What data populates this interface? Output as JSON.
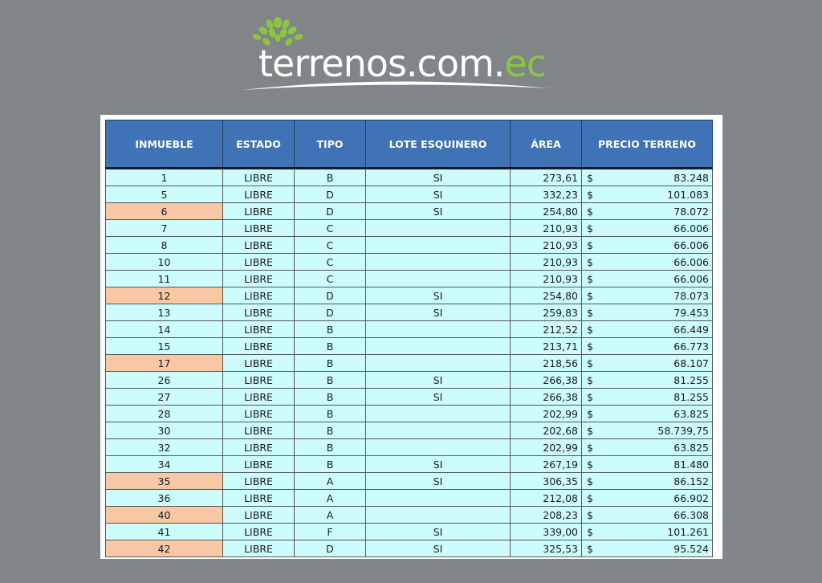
{
  "brand": {
    "name_main": "terrenos.com.",
    "name_tld": "ec",
    "colors": {
      "leaf": "#8cc63f",
      "text": "#ffffff",
      "background": "#808587"
    }
  },
  "table": {
    "columns": [
      "INMUEBLE",
      "ESTADO",
      "TIPO",
      "LOTE ESQUINERO",
      "ÁREA",
      "PRECIO TERRENO"
    ],
    "currency_symbol": "$",
    "header_color": "#3f73b5",
    "cell_color": "#ccfcfc",
    "highlight_color": "#f8c8a4",
    "rows": [
      {
        "inmueble": "1",
        "estado": "LIBRE",
        "tipo": "B",
        "esquinero": "SI",
        "area": "273,61",
        "precio": "83.248",
        "highlight": false
      },
      {
        "inmueble": "5",
        "estado": "LIBRE",
        "tipo": "D",
        "esquinero": "SI",
        "area": "332,23",
        "precio": "101.083",
        "highlight": false
      },
      {
        "inmueble": "6",
        "estado": "LIBRE",
        "tipo": "D",
        "esquinero": "SI",
        "area": "254,80",
        "precio": "78.072",
        "highlight": true
      },
      {
        "inmueble": "7",
        "estado": "LIBRE",
        "tipo": "C",
        "esquinero": "",
        "area": "210,93",
        "precio": "66.006",
        "highlight": false
      },
      {
        "inmueble": "8",
        "estado": "LIBRE",
        "tipo": "C",
        "esquinero": "",
        "area": "210,93",
        "precio": "66.006",
        "highlight": false
      },
      {
        "inmueble": "10",
        "estado": "LIBRE",
        "tipo": "C",
        "esquinero": "",
        "area": "210,93",
        "precio": "66.006",
        "highlight": false
      },
      {
        "inmueble": "11",
        "estado": "LIBRE",
        "tipo": "C",
        "esquinero": "",
        "area": "210,93",
        "precio": "66.006",
        "highlight": false
      },
      {
        "inmueble": "12",
        "estado": "LIBRE",
        "tipo": "D",
        "esquinero": "SI",
        "area": "254,80",
        "precio": "78.073",
        "highlight": true
      },
      {
        "inmueble": "13",
        "estado": "LIBRE",
        "tipo": "D",
        "esquinero": "SI",
        "area": "259,83",
        "precio": "79.453",
        "highlight": false
      },
      {
        "inmueble": "14",
        "estado": "LIBRE",
        "tipo": "B",
        "esquinero": "",
        "area": "212,52",
        "precio": "66.449",
        "highlight": false
      },
      {
        "inmueble": "15",
        "estado": "LIBRE",
        "tipo": "B",
        "esquinero": "",
        "area": "213,71",
        "precio": "66.773",
        "highlight": false
      },
      {
        "inmueble": "17",
        "estado": "LIBRE",
        "tipo": "B",
        "esquinero": "",
        "area": "218,56",
        "precio": "68.107",
        "highlight": true
      },
      {
        "inmueble": "26",
        "estado": "LIBRE",
        "tipo": "B",
        "esquinero": "SI",
        "area": "266,38",
        "precio": "81.255",
        "highlight": false
      },
      {
        "inmueble": "27",
        "estado": "LIBRE",
        "tipo": "B",
        "esquinero": "SI",
        "area": "266,38",
        "precio": "81.255",
        "highlight": false
      },
      {
        "inmueble": "28",
        "estado": "LIBRE",
        "tipo": "B",
        "esquinero": "",
        "area": "202,99",
        "precio": "63.825",
        "highlight": false
      },
      {
        "inmueble": "30",
        "estado": "LIBRE",
        "tipo": "B",
        "esquinero": "",
        "area": "202,68",
        "precio": "58.739,75",
        "highlight": false
      },
      {
        "inmueble": "32",
        "estado": "LIBRE",
        "tipo": "B",
        "esquinero": "",
        "area": "202,99",
        "precio": "63.825",
        "highlight": false
      },
      {
        "inmueble": "34",
        "estado": "LIBRE",
        "tipo": "B",
        "esquinero": "SI",
        "area": "267,19",
        "precio": "81.480",
        "highlight": false
      },
      {
        "inmueble": "35",
        "estado": "LIBRE",
        "tipo": "A",
        "esquinero": "SI",
        "area": "306,35",
        "precio": "86.152",
        "highlight": true
      },
      {
        "inmueble": "36",
        "estado": "LIBRE",
        "tipo": "A",
        "esquinero": "",
        "area": "212,08",
        "precio": "66.902",
        "highlight": false
      },
      {
        "inmueble": "40",
        "estado": "LIBRE",
        "tipo": "A",
        "esquinero": "",
        "area": "208,23",
        "precio": "66.308",
        "highlight": true
      },
      {
        "inmueble": "41",
        "estado": "LIBRE",
        "tipo": "F",
        "esquinero": "SI",
        "area": "339,00",
        "precio": "101.261",
        "highlight": false
      },
      {
        "inmueble": "42",
        "estado": "LIBRE",
        "tipo": "D",
        "esquinero": "SI",
        "area": "325,53",
        "precio": "95.524",
        "highlight": true
      }
    ]
  }
}
